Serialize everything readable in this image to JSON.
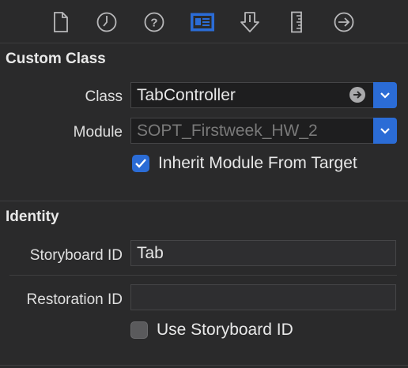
{
  "toolbar": {
    "icons": [
      {
        "name": "file-inspector-icon"
      },
      {
        "name": "history-inspector-icon"
      },
      {
        "name": "quick-help-icon"
      },
      {
        "name": "identity-inspector-icon",
        "selected": true
      },
      {
        "name": "attributes-inspector-icon"
      },
      {
        "name": "size-inspector-icon"
      },
      {
        "name": "connections-inspector-icon"
      }
    ]
  },
  "custom_class": {
    "title": "Custom Class",
    "class_label": "Class",
    "class_value": "TabController",
    "module_label": "Module",
    "module_value": "SOPT_Firstweek_HW_2",
    "inherit_label": "Inherit Module From Target",
    "inherit_checked": true
  },
  "identity": {
    "title": "Identity",
    "storyboard_id_label": "Storyboard ID",
    "storyboard_id_value": "Tab",
    "restoration_id_label": "Restoration ID",
    "restoration_id_value": "",
    "use_storyboard_label": "Use Storyboard ID",
    "use_storyboard_checked": false
  },
  "colors": {
    "background": "#2a2a2b",
    "accent": "#2b6cd6",
    "icon": "#b8b8ba"
  }
}
